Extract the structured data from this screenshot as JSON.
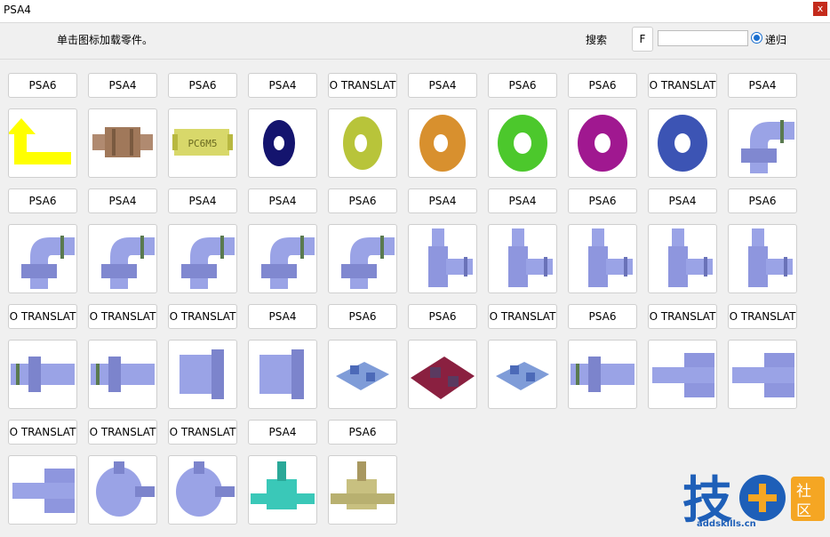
{
  "window": {
    "title": "PSA4",
    "close_label": "x"
  },
  "toolbar": {
    "hint": "单击图标加载零件。",
    "search_label": "搜索",
    "f_label": "F",
    "search_value": "",
    "recursive_label": "递归"
  },
  "parts": [
    {
      "label": "PSA6",
      "icon": "yellow-arrow-icon"
    },
    {
      "label": "PSA4",
      "icon": "bronze-fitting-icon"
    },
    {
      "label": "PSA6",
      "icon": "brass-fitting-icon"
    },
    {
      "label": "PSA4",
      "icon": "navy-washer-icon"
    },
    {
      "label": "O TRANSLAT",
      "icon": "yellow-washer-icon"
    },
    {
      "label": "PSA4",
      "icon": "orange-washer-icon"
    },
    {
      "label": "PSA6",
      "icon": "green-washer-icon"
    },
    {
      "label": "PSA6",
      "icon": "purple-washer-icon"
    },
    {
      "label": "O TRANSLAT",
      "icon": "blue-washer-icon"
    },
    {
      "label": "PSA4",
      "icon": "elbow-fitting-icon"
    },
    {
      "label": "PSA6",
      "icon": "elbow-fitting-icon"
    },
    {
      "label": "PSA4",
      "icon": "elbow-fitting-icon"
    },
    {
      "label": "PSA4",
      "icon": "elbow-fitting-icon"
    },
    {
      "label": "PSA4",
      "icon": "elbow-fitting-icon"
    },
    {
      "label": "PSA6",
      "icon": "elbow-fitting-icon"
    },
    {
      "label": "PSA4",
      "icon": "flow-valve-icon"
    },
    {
      "label": "PSA4",
      "icon": "flow-valve-icon"
    },
    {
      "label": "PSA6",
      "icon": "flow-valve-icon"
    },
    {
      "label": "PSA4",
      "icon": "flow-valve-icon"
    },
    {
      "label": "PSA6",
      "icon": "flow-valve-icon"
    },
    {
      "label": "O TRANSLAT",
      "icon": "straight-fitting-icon"
    },
    {
      "label": "O TRANSLAT",
      "icon": "straight-fitting-icon"
    },
    {
      "label": "O TRANSLAT",
      "icon": "reducer-icon"
    },
    {
      "label": "PSA4",
      "icon": "reducer-icon"
    },
    {
      "label": "PSA6",
      "icon": "bracket-icon"
    },
    {
      "label": "PSA6",
      "icon": "maroon-bracket-icon"
    },
    {
      "label": "O TRANSLAT",
      "icon": "bracket-icon"
    },
    {
      "label": "PSA6",
      "icon": "straight-fitting-icon"
    },
    {
      "label": "O TRANSLAT",
      "icon": "y-fitting-icon"
    },
    {
      "label": "O TRANSLAT",
      "icon": "y-fitting-icon"
    },
    {
      "label": "O TRANSLAT",
      "icon": "y-fitting-icon"
    },
    {
      "label": "O TRANSLAT",
      "icon": "valve-icon"
    },
    {
      "label": "O TRANSLAT",
      "icon": "valve-icon"
    },
    {
      "label": "PSA4",
      "icon": "teal-valve-icon"
    },
    {
      "label": "PSA6",
      "icon": "olive-valve-icon"
    }
  ],
  "watermark": {
    "text": "技+社区",
    "url": "addskills.cn"
  },
  "colors": {
    "part_metal": "#9aa3e6",
    "accent": "#1a6fcf"
  }
}
